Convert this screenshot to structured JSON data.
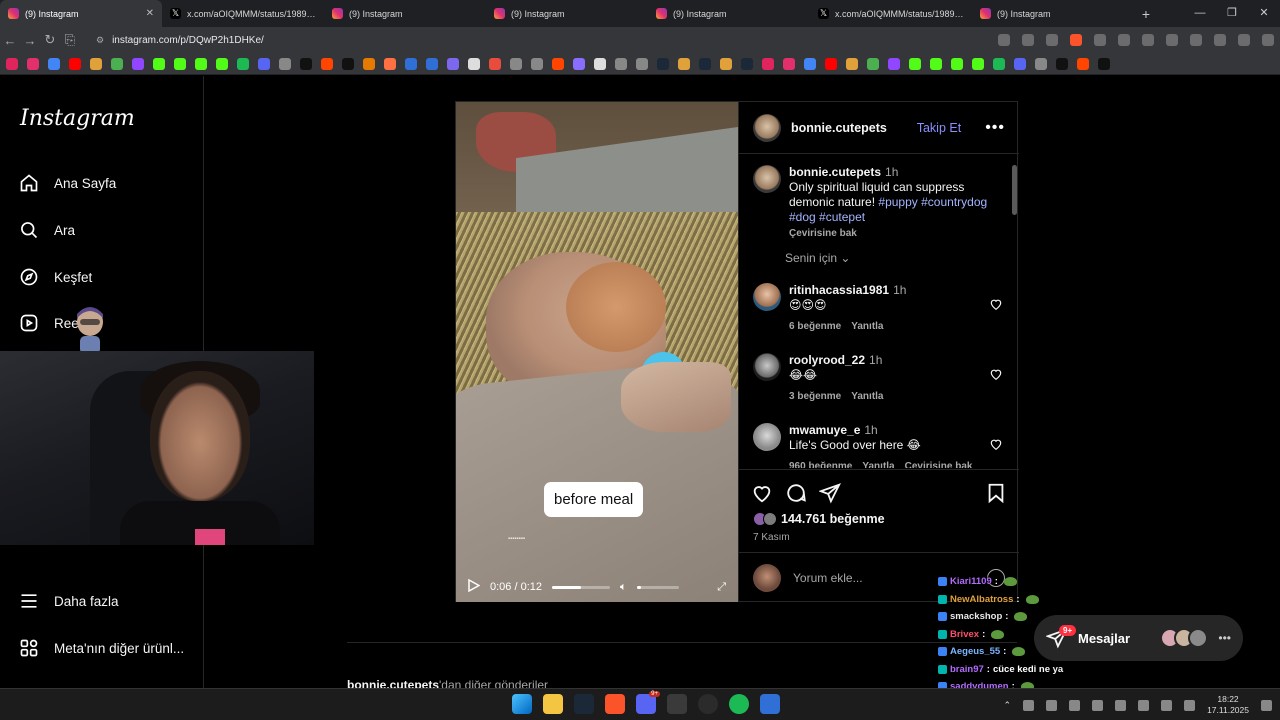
{
  "browser": {
    "tabs": [
      {
        "title": "(9) Instagram",
        "icon": "instagram",
        "active": true
      },
      {
        "title": "x.com/aOIQMMM/status/198958768",
        "icon": "x"
      },
      {
        "title": "(9) Instagram",
        "icon": "instagram"
      },
      {
        "title": "(9) Instagram",
        "icon": "instagram"
      },
      {
        "title": "(9) Instagram",
        "icon": "instagram"
      },
      {
        "title": "x.com/aOIQMMM/status/198958768",
        "icon": "x"
      },
      {
        "title": "(9) Instagram",
        "icon": "instagram"
      }
    ],
    "url": "instagram.com/p/DQwP2h1DHKe/",
    "accent": "#fb542b"
  },
  "sidebar": {
    "logo": "Instagram",
    "items": [
      {
        "label": "Ana Sayfa",
        "icon": "home-icon"
      },
      {
        "label": "Ara",
        "icon": "search-icon"
      },
      {
        "label": "Keşfet",
        "icon": "compass-icon"
      },
      {
        "label": "Reels",
        "icon": "reels-icon"
      },
      {
        "label": "Daha fazla",
        "icon": "menu-icon"
      },
      {
        "label": "Meta'nın diğer ürünl...",
        "icon": "apps-icon"
      }
    ]
  },
  "post": {
    "username": "bonnie.cutepets",
    "follow_label": "Takip Et",
    "caption": {
      "username": "bonnie.cutepets",
      "time": "1h",
      "text": "Only spiritual liquid can suppress demonic nature!",
      "tags": [
        "#puppy",
        "#countrydog",
        "#dog",
        "#cutepet"
      ],
      "translate": "Çevirisine bak"
    },
    "sort_label": "Senin için",
    "comments": [
      {
        "user": "ritinhacassia1981",
        "time": "1h",
        "text": "😍😍😍",
        "likes": "6 beğenme",
        "reply": "Yanıtla",
        "translate": ""
      },
      {
        "user": "roolyrood_22",
        "time": "1h",
        "text": "😂😂",
        "likes": "3 beğenme",
        "reply": "Yanıtla",
        "translate": ""
      },
      {
        "user": "mwamuye_e",
        "time": "1h",
        "text": "Life's Good over here 😂",
        "likes": "960 beğenme",
        "reply": "Yanıtla",
        "translate": "Çevirisine bak"
      }
    ],
    "like_count": "144.761 beğenme",
    "date": "7 Kasım",
    "comment_placeholder": "Yorum ekle...",
    "video": {
      "overlay_text": "before meal",
      "time": "0:06 / 0:12",
      "progress": 0.5,
      "volume": 0.1
    }
  },
  "more_posts": {
    "user": "bonnie.cutepets",
    "suffix": "'dan diğer gönderiler"
  },
  "chat": [
    {
      "user": "Kiari1109",
      "color": "#b36cff"
    },
    {
      "user": "NewAlbatross",
      "color": "#e0a03a"
    },
    {
      "user": "smackshop",
      "color": "#e8e8e8"
    },
    {
      "user": "Brivex",
      "color": "#ff4d6a"
    },
    {
      "user": "Aegeus_55",
      "color": "#7ab6ff"
    },
    {
      "user": "brain97",
      "color": "#b36cff",
      "message": "cüce kedi ne ya"
    },
    {
      "user": "saddydumen",
      "color": "#b36cff"
    }
  ],
  "messages": {
    "label": "Mesajlar",
    "badge": "9+"
  },
  "taskbar": {
    "time": "18:22",
    "date": "17.11.2025",
    "discord_badge": "9+"
  }
}
